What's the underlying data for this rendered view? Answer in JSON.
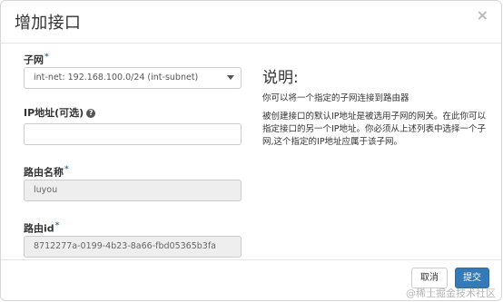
{
  "dialog": {
    "title": "增加接口",
    "close_glyph": "×"
  },
  "form": {
    "subnet": {
      "label": "子网",
      "required_mark": "*",
      "value": "int-net: 192.168.100.0/24 (int-subnet)"
    },
    "ip": {
      "label": "IP地址(可选)",
      "help_glyph": "?",
      "value": ""
    },
    "router_name": {
      "label": "路由名称",
      "required_mark": "*",
      "value": "luyou"
    },
    "router_id": {
      "label": "路由id",
      "required_mark": "*",
      "value": "8712277a-0199-4b23-8a66-fbd05365b3fa"
    }
  },
  "description": {
    "title": "说明:",
    "p1": "你可以将一个指定的子网连接到路由器",
    "p2": "被创建接口的默认IP地址是被选用子网的网关。在此你可以指定接口的另一个IP地址。你必须从上述列表中选择一个子网,这个指定的IP地址应属于该子网。"
  },
  "footer": {
    "cancel_label": "取消",
    "submit_label": "提交"
  },
  "watermark": "@稀土掘金技术社区",
  "colors": {
    "primary": "#337ab7",
    "required": "#2d7ab8"
  }
}
